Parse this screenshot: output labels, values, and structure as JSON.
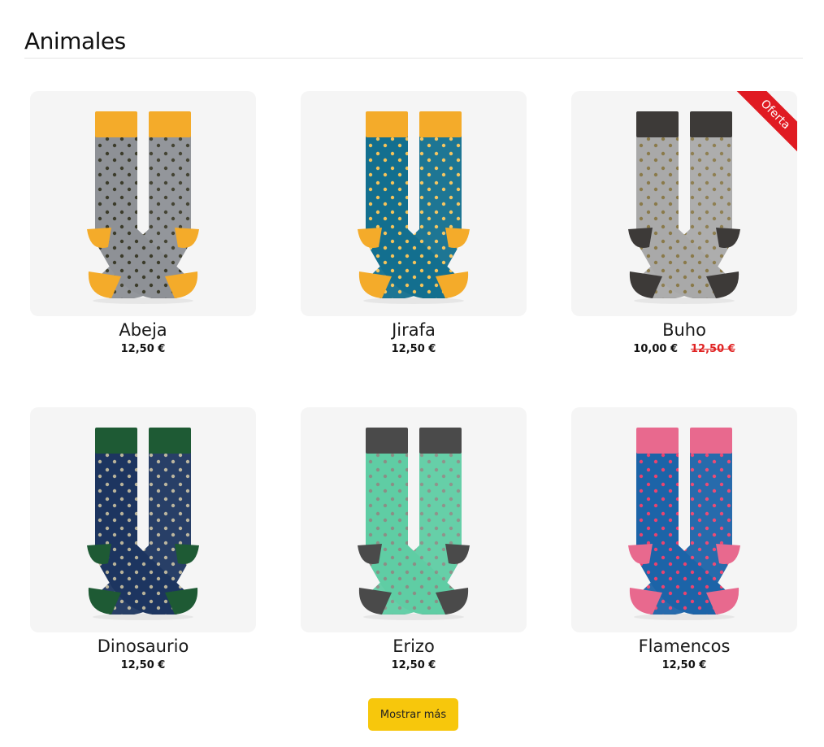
{
  "section": {
    "title": "Animales"
  },
  "products": [
    {
      "name": "Abeja",
      "price": "12,50 €",
      "old_price": "",
      "badge": "",
      "colors": {
        "cuff": "#f4ab2a",
        "body": "#8e9196",
        "heel": "#f4ab2a",
        "toe": "#f4ab2a",
        "pattern": "#3b3b2a"
      }
    },
    {
      "name": "Jirafa",
      "price": "12,50 €",
      "old_price": "",
      "badge": "",
      "colors": {
        "cuff": "#f4ab2a",
        "body": "#136f8f",
        "heel": "#f4ab2a",
        "toe": "#f4ab2a",
        "pattern": "#f4c35a"
      }
    },
    {
      "name": "Buho",
      "price": "10,00 €",
      "old_price": "12,50 €",
      "badge": "Oferta",
      "colors": {
        "cuff": "#3d3a38",
        "body": "#a9a9a9",
        "heel": "#3d3a38",
        "toe": "#3d3a38",
        "pattern": "#8a7a4a"
      }
    },
    {
      "name": "Dinosaurio",
      "price": "12,50 €",
      "old_price": "",
      "badge": "",
      "colors": {
        "cuff": "#1e5a34",
        "body": "#1d3560",
        "heel": "#1e5a34",
        "toe": "#1e5a34",
        "pattern": "#b9b39a"
      }
    },
    {
      "name": "Erizo",
      "price": "12,50 €",
      "old_price": "",
      "badge": "",
      "colors": {
        "cuff": "#4a4a4a",
        "body": "#5fcda4",
        "heel": "#4a4a4a",
        "toe": "#4a4a4a",
        "pattern": "#8a8f86"
      }
    },
    {
      "name": "Flamencos",
      "price": "12,50 €",
      "old_price": "",
      "badge": "",
      "colors": {
        "cuff": "#e8698e",
        "body": "#1c64a8",
        "heel": "#e8698e",
        "toe": "#e8698e",
        "pattern": "#e9436f"
      }
    }
  ],
  "load_more": {
    "label": "Mostrar más"
  }
}
